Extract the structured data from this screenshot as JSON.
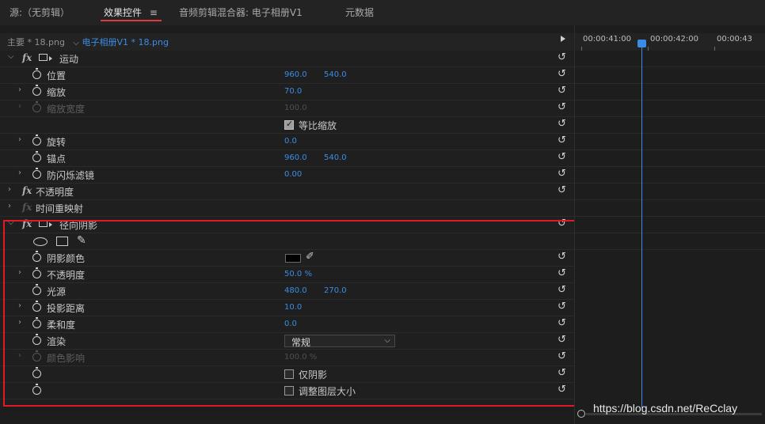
{
  "tabs": {
    "source": "源:（无剪辑）",
    "effect_controls": "效果控件",
    "menu_glyph": "≡",
    "audio_mixer": "音频剪辑混合器: 电子相册V1",
    "metadata": "元数据"
  },
  "clip": {
    "master": "主要 * 18.png",
    "sequence": "电子相册V1 * 18.png"
  },
  "timeline": {
    "tc1": "00:00:41:00",
    "tc2": "00:00:42:00",
    "tc3": "00:00:43"
  },
  "rows": {
    "motion": "运动",
    "position": "位置",
    "position_x": "960.0",
    "position_y": "540.0",
    "scale": "缩放",
    "scale_val": "70.0",
    "scale_width": "缩放宽度",
    "scale_width_val": "100.0",
    "uniform_scale": "等比缩放",
    "rotation": "旋转",
    "rotation_val": "0.0",
    "anchor": "锚点",
    "anchor_x": "960.0",
    "anchor_y": "540.0",
    "anti_flicker": "防闪烁滤镜",
    "anti_flicker_val": "0.00",
    "opacity_fx": "不透明度",
    "time_remap": "时间重映射",
    "radial_shadow": "径向阴影",
    "shadow_color": "阴影颜色",
    "opacity": "不透明度",
    "opacity_val": "50.0 %",
    "light_source": "光源",
    "light_x": "480.0",
    "light_y": "270.0",
    "projection_distance": "投影距离",
    "projection_distance_val": "10.0",
    "softness": "柔和度",
    "softness_val": "0.0",
    "render": "渲染",
    "render_val": "常规",
    "color_influence": "颜色影响",
    "color_influence_val": "100.0 %",
    "shadow_only": "仅阴影",
    "resize_layer": "调整图层大小"
  },
  "watermark": "https://blog.csdn.net/ReCclay",
  "colors": {
    "accent_blue": "#3a8de6",
    "highlight_red": "#e01b24"
  }
}
